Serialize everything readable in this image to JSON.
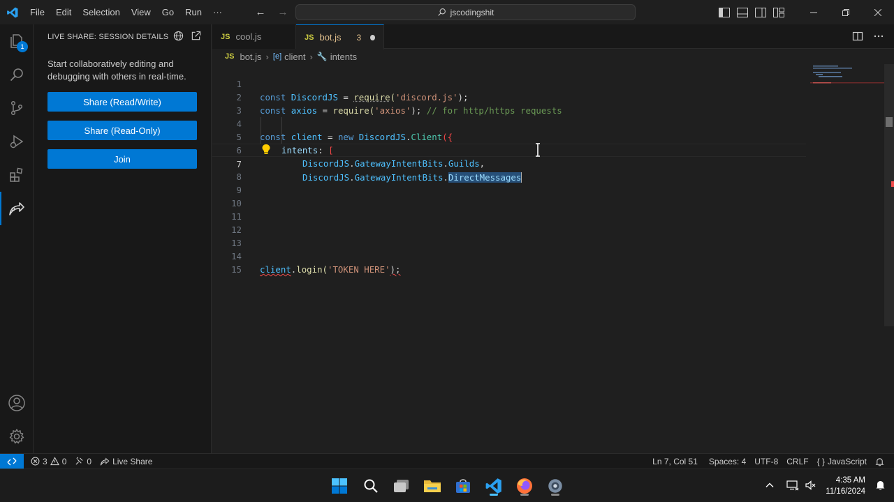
{
  "titlebar": {
    "menu": [
      "File",
      "Edit",
      "Selection",
      "View",
      "Go",
      "Run",
      "···"
    ],
    "search_text": "jscodingshit"
  },
  "activity": {
    "explorer_badge": "1"
  },
  "sidebar": {
    "title": "LIVE SHARE: SESSION DETAILS",
    "description": "Start collaboratively editing and debugging with others in real-time.",
    "buttons": [
      "Share (Read/Write)",
      "Share (Read-Only)",
      "Join"
    ]
  },
  "tabs": [
    {
      "icon": "JS",
      "label": "cool.js"
    },
    {
      "icon": "JS",
      "label": "bot.js",
      "problems": "3"
    }
  ],
  "breadcrumb": {
    "icon": "JS",
    "file": "bot.js",
    "symbol1": "client",
    "symbol2": "intents"
  },
  "editor": {
    "line_numbers": [
      "1",
      "2",
      "3",
      "4",
      "5",
      "6",
      "7",
      "8",
      "9",
      "10",
      "11",
      "12",
      "13",
      "14",
      "15"
    ],
    "l1": {
      "kw": "const",
      "name": "DiscordJS",
      "eq": " = ",
      "fn": "require",
      "open": "(",
      "str": "'discord.js'",
      "close": ");"
    },
    "l2": {
      "kw": "const",
      "name": "axios",
      "eq": " = ",
      "fn": "require",
      "open": "(",
      "str": "'axios'",
      "close": ");",
      "comment": "// for http/https requests"
    },
    "l4": {
      "kw": "const",
      "name": "client",
      "eq": " = ",
      "kw2": "new",
      "obj": "DiscordJS",
      "dot": ".",
      "cls": "Client",
      "open": "({"
    },
    "l5": {
      "prop": "intents",
      "colon": ": ",
      "open": "["
    },
    "l6": {
      "obj": "DiscordJS",
      "dot1": ".",
      "prop1": "GatewayIntentBits",
      "dot2": ".",
      "prop2": "Guilds",
      "comma": ","
    },
    "l7": {
      "obj": "DiscordJS",
      "dot1": ".",
      "prop1": "GatewayIntentBits",
      "dot2": ".",
      "prop2": "DirectMessages"
    },
    "l14": {
      "obj": "client",
      "dot": ".",
      "fn": "login",
      "open": "(",
      "str": "'TOKEN HERE'",
      "close": ");"
    }
  },
  "statusbar": {
    "errors": "3",
    "warnings": "0",
    "ports": "0",
    "liveshare": "Live Share",
    "position": "Ln 7, Col 51",
    "spaces": "Spaces: 4",
    "encoding": "UTF-8",
    "eol": "CRLF",
    "language": "JavaScript"
  },
  "taskbar": {
    "time": "4:35 AM",
    "date": "11/16/2024"
  },
  "colors": {
    "accent": "#0078d4",
    "error": "#f14c4c",
    "warning_tab": "#e2c08d"
  }
}
